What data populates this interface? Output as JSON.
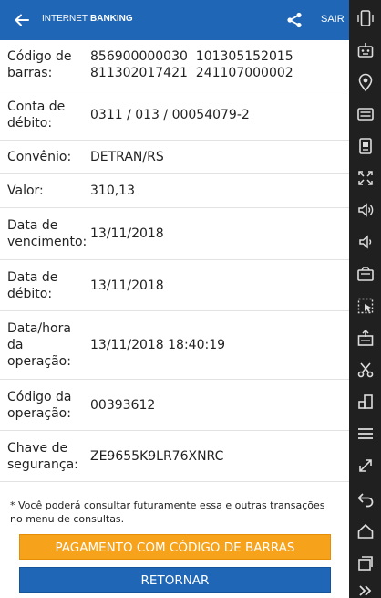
{
  "header": {
    "brand_light": "INTERNET",
    "brand_bold": "BANKING",
    "exit_label": "SAIR",
    "back_icon": "arrow-left-icon",
    "share_icon": "share-icon",
    "background": "#1f66b6"
  },
  "details": [
    {
      "label": [
        "Código de",
        "barras:"
      ],
      "value": [
        "856900000030  101305152015",
        "811302017421  241107000002"
      ]
    },
    {
      "label": [
        "Conta de",
        "débito:"
      ],
      "value": [
        "0311 / 013 / 00054079-2"
      ]
    },
    {
      "label": [
        "Convênio:"
      ],
      "value": [
        "DETRAN/RS"
      ]
    },
    {
      "label": [
        "Valor:"
      ],
      "value": [
        "310,13"
      ]
    },
    {
      "label": [
        "Data de",
        "vencimento:"
      ],
      "value": [
        "13/11/2018"
      ]
    },
    {
      "label": [
        "Data de",
        "débito:"
      ],
      "value": [
        "13/11/2018"
      ]
    },
    {
      "label": [
        "Data/hora",
        "da",
        "operação:"
      ],
      "value": [
        "13/11/2018 18:40:19"
      ]
    },
    {
      "label": [
        "Código da",
        "operação:"
      ],
      "value": [
        "00393612"
      ]
    },
    {
      "label": [
        "Chave de",
        "segurança:"
      ],
      "value": [
        "ZE9655K9LR76XNRC"
      ]
    }
  ],
  "note": "* Você poderá consultar futuramente essa e outras transações no menu de consultas.",
  "buttons": {
    "barcode_payment": "PAGAMENTO COM CÓDIGO DE BARRAS",
    "return": "RETORNAR",
    "orange": "#f7a21b",
    "blue": "#1f66b6"
  },
  "sidebar": {
    "icons": [
      "phone-shake-icon",
      "robot-icon",
      "location-pin-icon",
      "keyboard-icon",
      "sd-card-icon",
      "fullscreen-icon",
      "volume-up-icon",
      "volume-down-icon",
      "camera-icon",
      "selection-icon",
      "install-apk-icon",
      "scissors-icon",
      "window-icon",
      "menu-icon",
      "resize-arrow-icon",
      "back-arrow-icon",
      "home-icon",
      "recent-apps-icon",
      "chevron-double-right-icon"
    ]
  }
}
